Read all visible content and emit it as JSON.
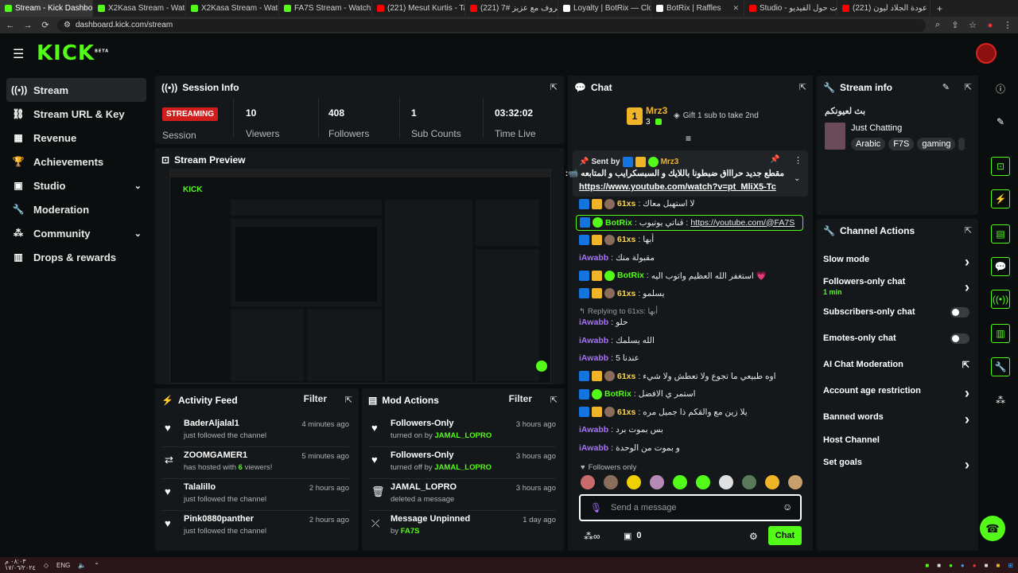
{
  "browser": {
    "tabs": [
      {
        "label": "Stream - Kick Dashboard",
        "color": "#53fc18"
      },
      {
        "label": "X2Kasa Stream - Watch Live o",
        "color": "#53fc18"
      },
      {
        "label": "X2Kasa Stream - Watch Live o",
        "color": "#53fc18"
      },
      {
        "label": "FA7S Stream - Watch Live on",
        "color": "#53fc18"
      },
      {
        "label": "(221) Mesut Kurtis - Tabasson",
        "color": "#ff0000"
      },
      {
        "label": "(221) حروف مع عزيز #7 …",
        "color": "#ff0000"
      },
      {
        "label": "Loyalty | BotRix — Cloud Stre",
        "color": "#ffffff"
      },
      {
        "label": "BotRix | Raffles",
        "color": "#ffffff"
      },
      {
        "label": "Studio - إحصائيات حول الفيديو",
        "color": "#ff0000"
      },
      {
        "label": "(221) عودة الجلاد ليون …",
        "color": "#ff0000"
      }
    ],
    "url": "dashboard.kick.com/stream"
  },
  "logo": {
    "text": "KICK",
    "sup": "BETA"
  },
  "sidebar": {
    "items": [
      {
        "label": "Stream",
        "icon": "stream-icon"
      },
      {
        "label": "Stream URL & Key",
        "icon": "link-icon"
      },
      {
        "label": "Revenue",
        "icon": "revenue-icon"
      },
      {
        "label": "Achievements",
        "icon": "trophy-icon"
      },
      {
        "label": "Studio",
        "icon": "studio-icon"
      },
      {
        "label": "Moderation",
        "icon": "wrench-icon"
      },
      {
        "label": "Community",
        "icon": "community-icon"
      },
      {
        "label": "Drops & rewards",
        "icon": "drops-icon"
      }
    ]
  },
  "session": {
    "title": "Session Info",
    "status": "STREAMING",
    "status_label": "Session",
    "viewers": "10",
    "viewers_label": "Viewers",
    "followers": "408",
    "followers_label": "Followers",
    "subs": "1",
    "subs_label": "Sub Counts",
    "time": "03:32:02",
    "time_label": "Time Live"
  },
  "preview": {
    "title": "Stream Preview"
  },
  "activity": {
    "title": "Activity Feed",
    "filter": "Filter",
    "items": [
      {
        "name": "BaderAljalal1",
        "sub": "just followed the channel",
        "time": "4 minutes ago"
      },
      {
        "name": "ZOOMGAMER1",
        "sub_pre": "has hosted with ",
        "sub_num": "6",
        "sub_post": " viewers!",
        "time": "5 minutes ago"
      },
      {
        "name": "Talalillo",
        "sub": "just followed the channel",
        "time": "2 hours ago"
      },
      {
        "name": "Pink0880panther",
        "sub": "just followed the channel",
        "time": "2 hours ago"
      }
    ]
  },
  "mod": {
    "title": "Mod Actions",
    "filter": "Filter",
    "items": [
      {
        "name": "Followers-Only",
        "sub": "turned on by ",
        "by": "JAMAL_LOPRO",
        "time": "3 hours ago"
      },
      {
        "name": "Followers-Only",
        "sub": "turned off by ",
        "by": "JAMAL_LOPRO",
        "time": "3 hours ago"
      },
      {
        "name": "JAMAL_LOPRO",
        "sub": "deleted a message",
        "by": "",
        "time": "3 hours ago"
      },
      {
        "name": "Message Unpinned",
        "sub": "by ",
        "by": "FA7S",
        "time": "1 day ago"
      }
    ]
  },
  "chat": {
    "title": "Chat",
    "gifter": {
      "rank": "1",
      "name": "Mrz3",
      "count": "3",
      "cta": "Gift 1 sub to take 2nd"
    },
    "pinned": {
      "sent_by": "Sent by",
      "user": "Mrz3",
      "text": "مقطع جديد حراااق ضبطونا باللايك و السبسكرايب و المتابعه 📹:",
      "link": "https://www.youtube.com/watch?v=pt_MliX5-Tc"
    },
    "messages": [
      {
        "user": "61xs",
        "color": "#ffd54a",
        "badges": [
          "blue",
          "gold",
          "av"
        ],
        "text": "لا استهبل معاك"
      },
      {
        "user": "BotRix",
        "color": "#53fc18",
        "badges": [
          "blue",
          "green"
        ],
        "text": "قناتي يوتيوب : ",
        "link": "https://youtube.com/@FA7S",
        "highlight": true
      },
      {
        "user": "61xs",
        "color": "#ffd54a",
        "badges": [
          "blue",
          "gold",
          "av"
        ],
        "text": "أبها"
      },
      {
        "user": "iAwabb",
        "color": "#a970ff",
        "badges": [],
        "text": "مقبولة منك"
      },
      {
        "user": "BotRix",
        "color": "#53fc18",
        "badges": [
          "blue",
          "gold",
          "green"
        ],
        "text": "استغفر الله العظيم واتوب اليه 💗"
      },
      {
        "user": "61xs",
        "color": "#ffd54a",
        "badges": [
          "blue",
          "gold",
          "av"
        ],
        "text": "يسلمو"
      },
      {
        "user": "iAwabb",
        "color": "#a970ff",
        "badges": [],
        "text": "حلو",
        "reply": "Replying to 61xs: أبها"
      },
      {
        "user": "iAwabb",
        "color": "#a970ff",
        "badges": [],
        "text": "الله يسلمك"
      },
      {
        "user": "iAwabb",
        "color": "#a970ff",
        "badges": [],
        "text": "5 عندنا"
      },
      {
        "user": "61xs",
        "color": "#ffd54a",
        "badges": [
          "blue",
          "gold",
          "av"
        ],
        "text": "اوه طبيعي ما تجوع ولا تعطش ولا شيء"
      },
      {
        "user": "BotRix",
        "color": "#53fc18",
        "badges": [
          "blue",
          "green"
        ],
        "text": "استمر ي الافضل"
      },
      {
        "user": "61xs",
        "color": "#ffd54a",
        "badges": [
          "blue",
          "gold",
          "av"
        ],
        "text": "يلا زين مع والقكم ذا جميل مره"
      },
      {
        "user": "iAwabb",
        "color": "#a970ff",
        "badges": [],
        "text": "بس بموت برد"
      },
      {
        "user": "iAwabb",
        "color": "#a970ff",
        "badges": [],
        "text": "و بموت من الوحدة"
      }
    ],
    "followers_only": "Followers only",
    "input_placeholder": "Send a message",
    "points": "0",
    "send": "Chat"
  },
  "stream_info": {
    "title": "Stream info",
    "stream_title": "بث لعيونكم",
    "category": "Just Chatting",
    "tags": [
      "Arabic",
      "F7S",
      "gaming"
    ]
  },
  "channel_actions": {
    "title": "Channel Actions",
    "items": [
      {
        "label": "Slow mode",
        "kind": "chevron"
      },
      {
        "label": "Followers-only chat",
        "sub": "1 min",
        "kind": "chevron"
      },
      {
        "label": "Subscribers-only chat",
        "kind": "toggle"
      },
      {
        "label": "Emotes-only chat",
        "kind": "toggle"
      },
      {
        "label": "AI Chat Moderation",
        "kind": "external"
      },
      {
        "label": "Account age restriction",
        "kind": "chevron"
      },
      {
        "label": "Banned words",
        "kind": "chevron"
      },
      {
        "label": "Host Channel",
        "kind": "none"
      },
      {
        "label": "Set goals",
        "kind": "chevron"
      }
    ]
  },
  "taskbar": {
    "lang": "ENG",
    "time": "٠٨:٠٣ م",
    "date": "١٧/٠٦/٢٠٢٤"
  },
  "colors": {
    "accent": "#53fc18",
    "live": "#d21d1d",
    "panel": "#15181a",
    "bg": "#0b0e0f"
  }
}
